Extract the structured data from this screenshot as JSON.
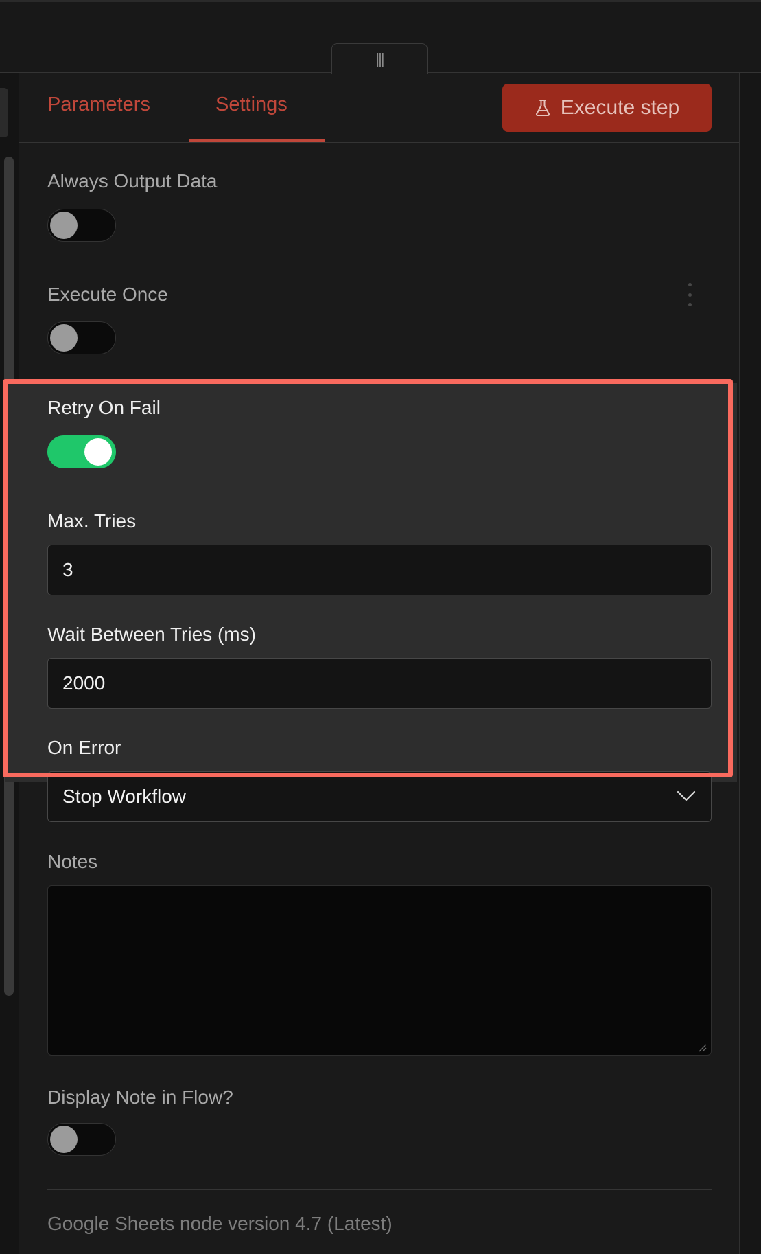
{
  "topbar": {
    "handle_glyph": "|||"
  },
  "tabs": {
    "parameters": "Parameters",
    "settings": "Settings",
    "active": "settings"
  },
  "execute_button": {
    "label": "Execute step",
    "icon": "flask-icon"
  },
  "settings": {
    "always_output_data": {
      "label": "Always Output Data",
      "enabled": false
    },
    "execute_once": {
      "label": "Execute Once",
      "enabled": false
    },
    "retry_on_fail": {
      "label": "Retry On Fail",
      "enabled": true
    },
    "max_tries": {
      "label": "Max. Tries",
      "value": "3"
    },
    "wait_between_tries": {
      "label": "Wait Between Tries (ms)",
      "value": "2000"
    },
    "on_error": {
      "label": "On Error",
      "value": "Stop Workflow"
    },
    "notes": {
      "label": "Notes",
      "value": ""
    },
    "display_note": {
      "label": "Display Note in Flow?",
      "enabled": false
    }
  },
  "footer": {
    "version": "Google Sheets node version 4.7 (Latest)"
  },
  "colors": {
    "accent": "#c0473a",
    "button_bg": "#9b2a1c",
    "toggle_on": "#1fc76a",
    "highlight": "#f96a5e"
  }
}
